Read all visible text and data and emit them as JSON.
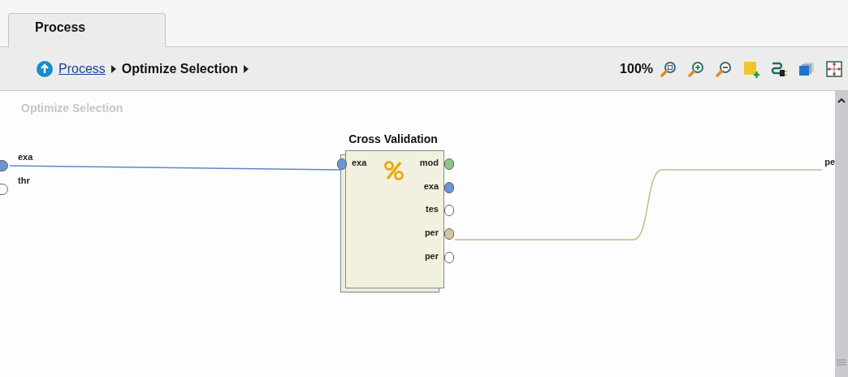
{
  "tabs": [
    {
      "label": "Process",
      "selected": true
    }
  ],
  "breadcrumb": [
    {
      "label": "Process",
      "kind": "link"
    },
    {
      "label": "Optimize Selection",
      "kind": "current"
    }
  ],
  "toolbar": {
    "zoom": "100%"
  },
  "canvas": {
    "title": "Optimize Selection",
    "inputs": [
      {
        "label": "exa",
        "color": "#6b93d6"
      },
      {
        "label": "thr",
        "color": "#ffffff"
      }
    ],
    "operator": {
      "name": "Cross Validation",
      "inputs": [
        {
          "label": "exa",
          "color": "#6b93d6"
        }
      ],
      "outputs": [
        {
          "label": "mod",
          "color": "#8cc68c"
        },
        {
          "label": "exa",
          "color": "#6b93d6"
        },
        {
          "label": "tes",
          "color": "#ffffff"
        },
        {
          "label": "per",
          "color": "#d8c4a4"
        },
        {
          "label": "per",
          "color": "#ffffff"
        }
      ]
    },
    "edge_outputs": [
      {
        "label": "pe"
      }
    ]
  }
}
